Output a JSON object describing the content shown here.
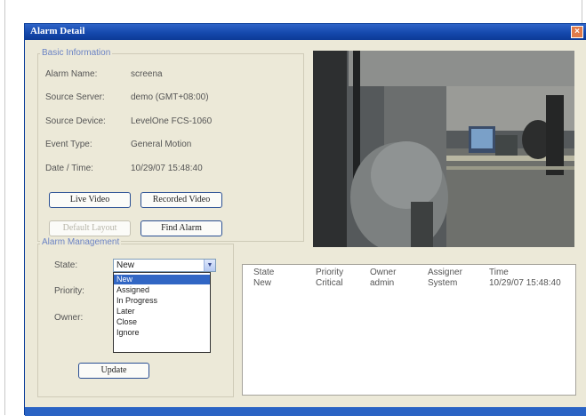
{
  "window": {
    "title": "Alarm Detail",
    "close_symbol": "×"
  },
  "basic_info": {
    "group_title": "Basic Information",
    "rows": [
      {
        "label": "Alarm Name:",
        "value": "screena"
      },
      {
        "label": "Source Server:",
        "value": "demo (GMT+08:00)"
      },
      {
        "label": "Source Device:",
        "value": "LevelOne FCS-1060"
      },
      {
        "label": "Event Type:",
        "value": "General Motion"
      },
      {
        "label": "Date / Time:",
        "value": "10/29/07 15:48:40"
      }
    ],
    "buttons": {
      "live_video": "Live Video",
      "recorded_video": "Recorded Video",
      "default_layout": "Default Layout",
      "find_alarm": "Find Alarm"
    }
  },
  "alarm_management": {
    "group_title": "Alarm Management",
    "state_label": "State:",
    "priority_label": "Priority:",
    "owner_label": "Owner:",
    "state_value": "New",
    "update_button": "Update",
    "state_options": [
      "New",
      "Assigned",
      "In Progress",
      "Later",
      "Close",
      "Ignore"
    ]
  },
  "history_table": {
    "columns": [
      "State",
      "Priority",
      "Owner",
      "Assigner",
      "Time"
    ],
    "rows": [
      [
        "New",
        "Critical",
        "admin",
        "System",
        "10/29/07 15:48:40"
      ]
    ]
  }
}
